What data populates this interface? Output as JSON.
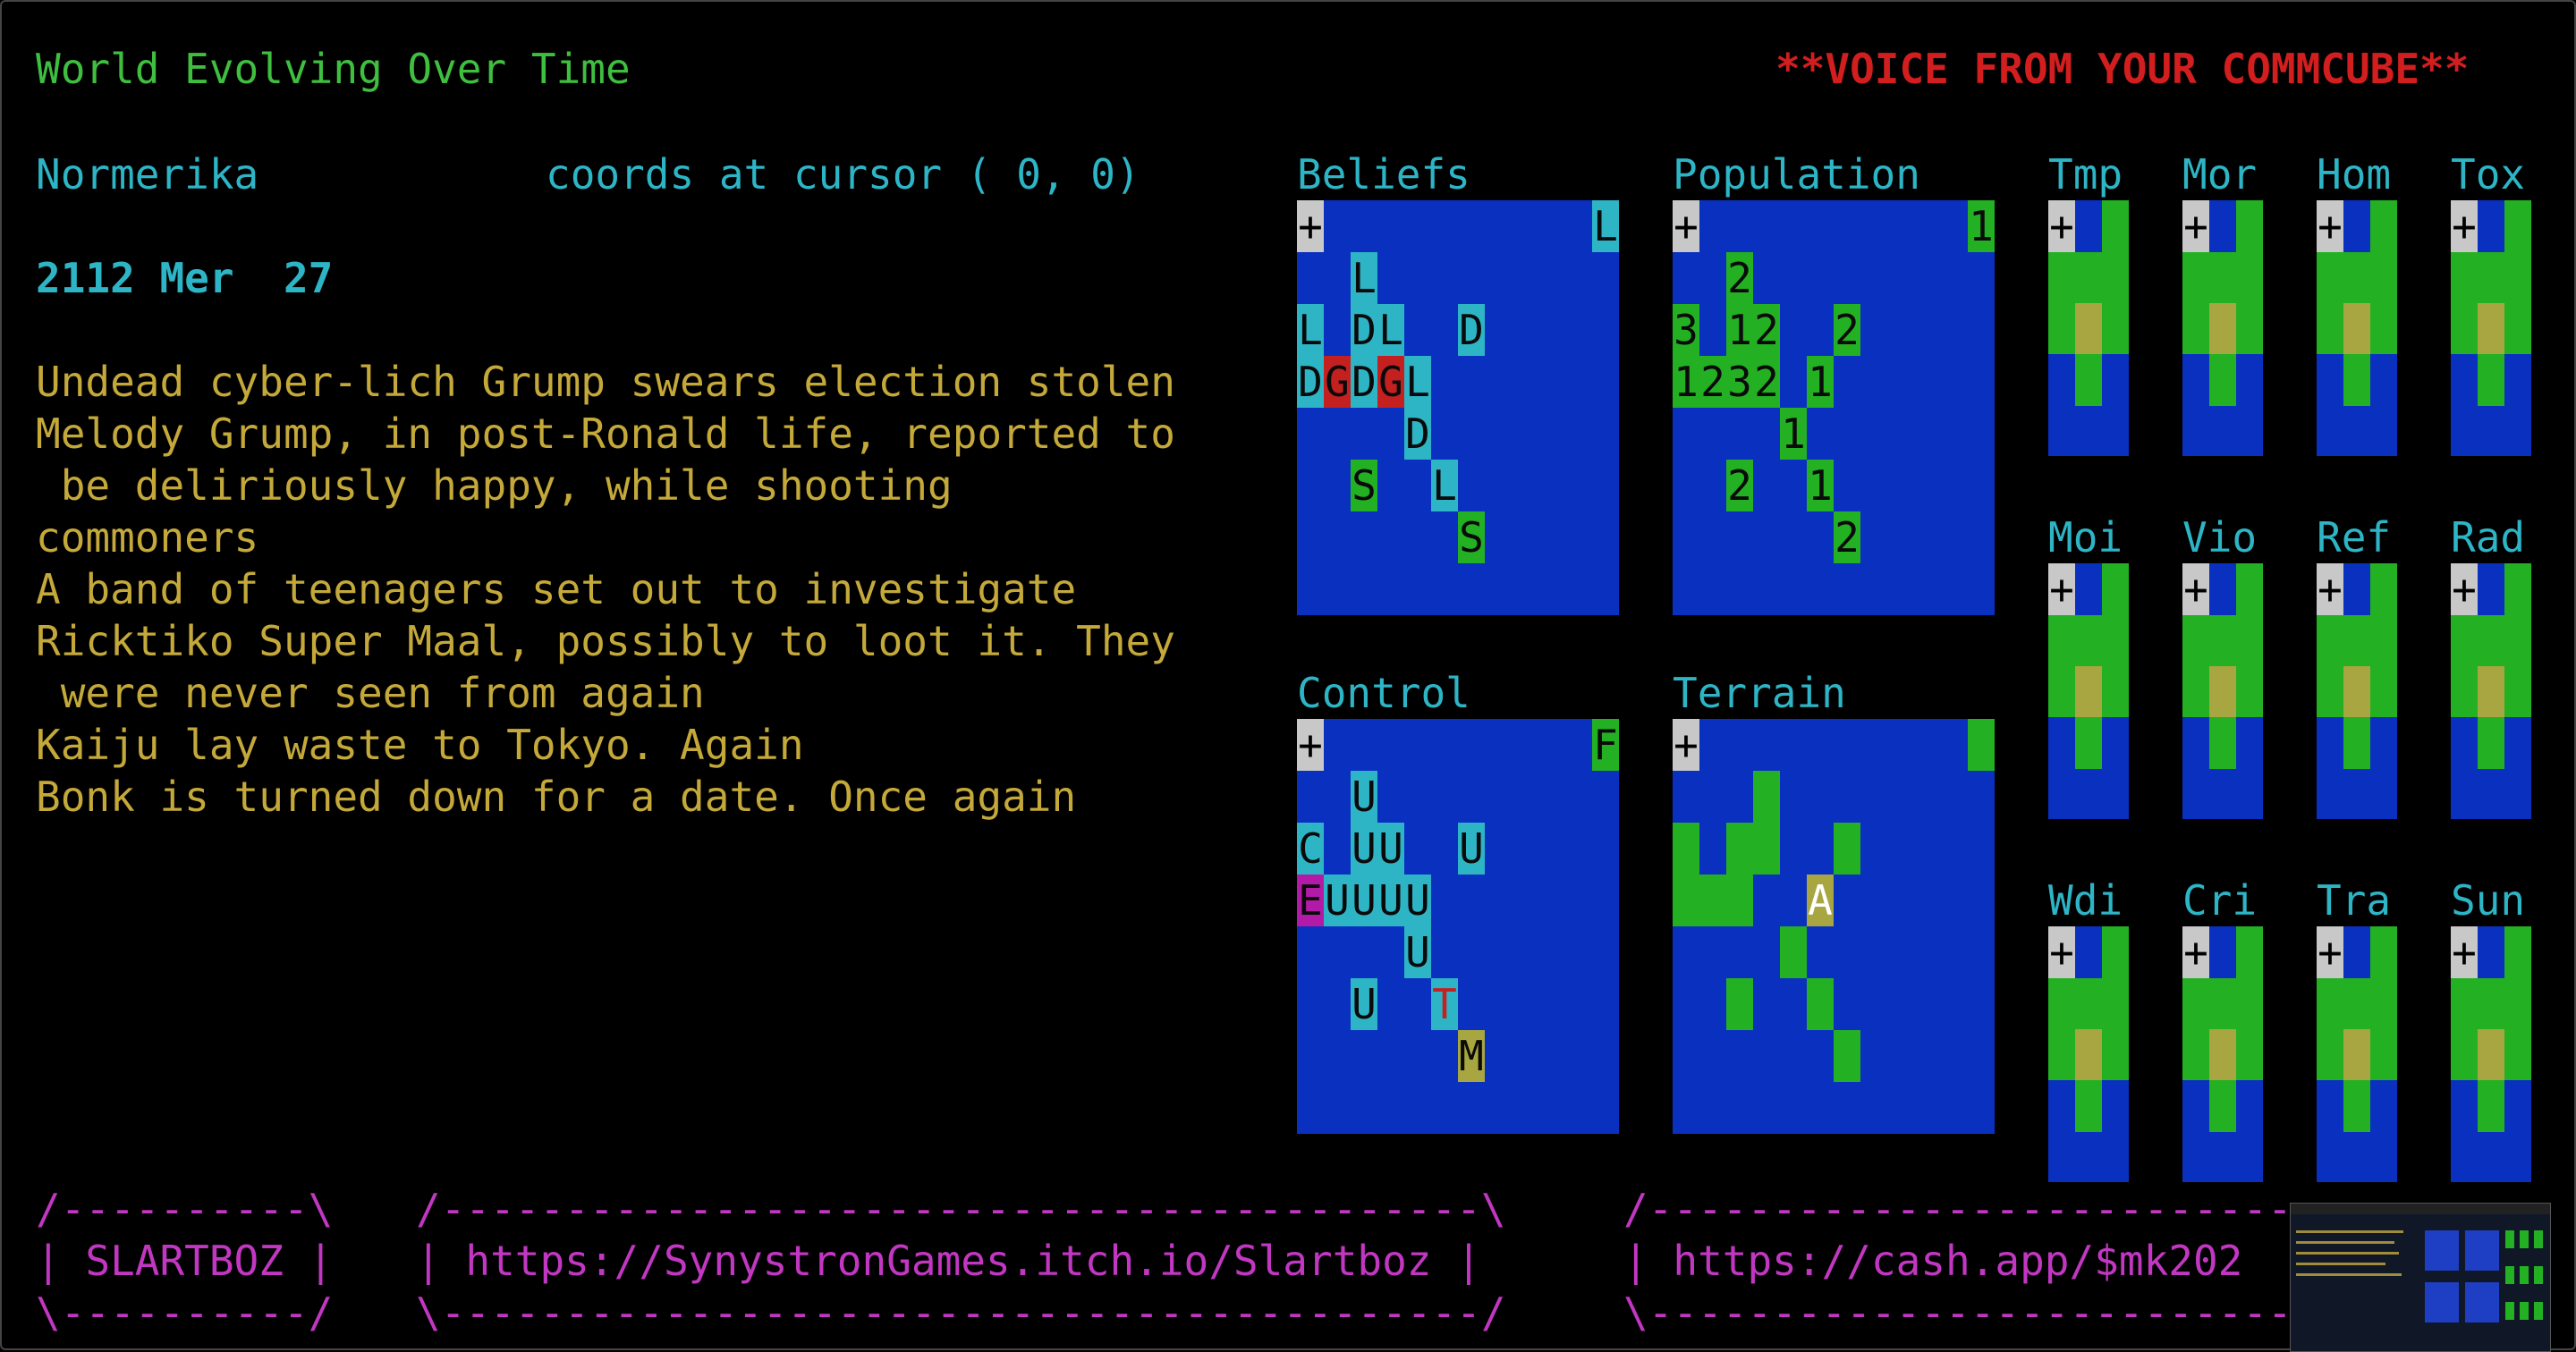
{
  "header": {
    "title": "World Evolving Over Time",
    "voice": "**VOICE FROM YOUR COMMCUBE**"
  },
  "location": {
    "region": "Normerika",
    "coords_text": "coords at cursor ( 0, 0)"
  },
  "date": "2112 Mer  27",
  "news": [
    "Undead cyber-lich Grump swears election stolen",
    "Melody Grump, in post-Ronald life, reported to",
    " be deliriously happy, while shooting",
    "commoners",
    "A band of teenagers set out to investigate",
    "Ricktiko Super Maal, possibly to loot it. They",
    " were never seen from again",
    "Kaiju lay waste to Tokyo. Again",
    "Bonk is turned down for a date. Once again"
  ],
  "maps": {
    "beliefs": {
      "title": "Beliefs",
      "plus": "+",
      "cells": [
        {
          "c": 5,
          "r": 0,
          "t": "L",
          "bg": "#2db5c6"
        },
        {
          "c": 1,
          "r": 1,
          "t": "L",
          "bg": "#2db5c6"
        },
        {
          "c": 0,
          "r": 2,
          "t": "L",
          "bg": "#2db5c6"
        },
        {
          "c": 1,
          "r": 2,
          "t": "D",
          "bg": "#2db5c6"
        },
        {
          "c": 1,
          "r": 2,
          "t": "L",
          "bg": "#2db5c6",
          "off": 1
        },
        {
          "c": 3,
          "r": 2,
          "t": "D",
          "bg": "#2db5c6"
        },
        {
          "c": 0,
          "r": 3,
          "t": "D",
          "bg": "#2db5c6"
        },
        {
          "c": 0,
          "r": 3,
          "t": "G",
          "bg": "#c42020",
          "off": 1
        },
        {
          "c": 1,
          "r": 3,
          "t": "D",
          "bg": "#2db5c6"
        },
        {
          "c": 1,
          "r": 3,
          "t": "G",
          "bg": "#c42020",
          "off": 1
        },
        {
          "c": 2,
          "r": 3,
          "t": "L",
          "bg": "#2db5c6"
        },
        {
          "c": 2,
          "r": 4,
          "t": "D",
          "bg": "#2db5c6"
        },
        {
          "c": 1,
          "r": 5,
          "t": "S",
          "bg": "#23b023"
        },
        {
          "c": 2,
          "r": 5,
          "t": "L",
          "bg": "#2db5c6",
          "off": 1
        },
        {
          "c": 3,
          "r": 6,
          "t": "S",
          "bg": "#23b023"
        }
      ]
    },
    "population": {
      "title": "Population",
      "plus": "+",
      "cells": [
        {
          "c": 5,
          "r": 0,
          "t": "1",
          "bg": "#23b023"
        },
        {
          "c": 1,
          "r": 1,
          "t": "2",
          "bg": "#23b023"
        },
        {
          "c": 0,
          "r": 2,
          "t": "3",
          "bg": "#23b023"
        },
        {
          "c": 1,
          "r": 2,
          "t": "1",
          "bg": "#23b023"
        },
        {
          "c": 1,
          "r": 2,
          "t": "2",
          "bg": "#23b023",
          "off": 1
        },
        {
          "c": 3,
          "r": 2,
          "t": "2",
          "bg": "#23b023"
        },
        {
          "c": 0,
          "r": 3,
          "t": "1",
          "bg": "#23b023"
        },
        {
          "c": 0,
          "r": 3,
          "t": "2",
          "bg": "#23b023",
          "off": 1
        },
        {
          "c": 1,
          "r": 3,
          "t": "3",
          "bg": "#23b023"
        },
        {
          "c": 1,
          "r": 3,
          "t": "2",
          "bg": "#23b023",
          "off": 1
        },
        {
          "c": 2,
          "r": 3,
          "t": "1",
          "bg": "#23b023",
          "off": 1
        },
        {
          "c": 2,
          "r": 4,
          "t": "1",
          "bg": "#23b023"
        },
        {
          "c": 1,
          "r": 5,
          "t": "2",
          "bg": "#23b023"
        },
        {
          "c": 2,
          "r": 5,
          "t": "1",
          "bg": "#23b023",
          "off": 1
        },
        {
          "c": 3,
          "r": 6,
          "t": "2",
          "bg": "#23b023"
        }
      ]
    },
    "control": {
      "title": "Control",
      "plus": "+",
      "cells": [
        {
          "c": 5,
          "r": 0,
          "t": "F",
          "bg": "#23b023"
        },
        {
          "c": 1,
          "r": 1,
          "t": "U",
          "bg": "#2db5c6"
        },
        {
          "c": 0,
          "r": 2,
          "t": "C",
          "bg": "#2db5c6"
        },
        {
          "c": 1,
          "r": 2,
          "t": "U",
          "bg": "#2db5c6"
        },
        {
          "c": 1,
          "r": 2,
          "t": "U",
          "bg": "#2db5c6",
          "off": 1
        },
        {
          "c": 3,
          "r": 2,
          "t": "U",
          "bg": "#2db5c6"
        },
        {
          "c": 0,
          "r": 3,
          "t": "E",
          "bg": "#b41aa8"
        },
        {
          "c": 0,
          "r": 3,
          "t": "U",
          "bg": "#2db5c6",
          "off": 1
        },
        {
          "c": 1,
          "r": 3,
          "t": "U",
          "bg": "#2db5c6"
        },
        {
          "c": 1,
          "r": 3,
          "t": "U",
          "bg": "#2db5c6",
          "off": 1
        },
        {
          "c": 2,
          "r": 3,
          "t": "U",
          "bg": "#2db5c6"
        },
        {
          "c": 2,
          "r": 4,
          "t": "U",
          "bg": "#2db5c6"
        },
        {
          "c": 1,
          "r": 5,
          "t": "U",
          "bg": "#2db5c6"
        },
        {
          "c": 2,
          "r": 5,
          "t": "T",
          "bg": "#2db5c6",
          "off": 1,
          "fg": "#c42020"
        },
        {
          "c": 3,
          "r": 6,
          "t": "M",
          "bg": "#a8a640"
        }
      ]
    },
    "terrain": {
      "title": "Terrain",
      "plus": "+",
      "blocks": [
        {
          "c": 5,
          "r": 0,
          "w": 1,
          "h": 1
        },
        {
          "c": 1,
          "r": 1,
          "w": 1,
          "h": 2,
          "off": 1
        },
        {
          "c": 0,
          "r": 2,
          "w": 1,
          "h": 2
        },
        {
          "c": 1,
          "r": 2,
          "w": 1,
          "h": 2
        },
        {
          "c": 0,
          "r": 3,
          "w": 2,
          "h": 1,
          "off": 1
        },
        {
          "c": 3,
          "r": 2,
          "w": 1,
          "h": 1
        },
        {
          "c": 2,
          "r": 4,
          "w": 1,
          "h": 1
        },
        {
          "c": 1,
          "r": 5,
          "w": 1,
          "h": 1
        },
        {
          "c": 2,
          "r": 5,
          "w": 1,
          "h": 1,
          "off": 1
        },
        {
          "c": 3,
          "r": 6,
          "w": 1,
          "h": 1
        }
      ],
      "special": {
        "c": 2,
        "r": 3,
        "t": "A",
        "bg": "#a8a640",
        "off": 1
      }
    }
  },
  "mini_charts": [
    {
      "label": "Tmp"
    },
    {
      "label": "Mor"
    },
    {
      "label": "Hom"
    },
    {
      "label": "Tox"
    },
    {
      "label": "Moi"
    },
    {
      "label": "Vio"
    },
    {
      "label": "Ref"
    },
    {
      "label": "Rad"
    },
    {
      "label": "Wdi"
    },
    {
      "label": "Cri"
    },
    {
      "label": "Tra"
    },
    {
      "label": "Sun"
    }
  ],
  "footer": {
    "box1_top": "/----------\\",
    "box1_mid": "| SLARTBOZ |",
    "box1_bot": "\\----------/",
    "box2_top": "/------------------------------------------\\",
    "box2_mid": "| https://SynystronGames.itch.io/Slartboz |",
    "box2_bot": "\\------------------------------------------/",
    "box3_top": "/--------------------------",
    "box3_mid": "| https://cash.app/$mk202",
    "box3_bot": "\\--------------------------"
  },
  "colors": {
    "green_text": "#3fbf3f",
    "cyan_text": "#2db5c6",
    "news_text": "#c4a93a",
    "voice_red": "#d21e1e",
    "footer_magenta": "#c237c2",
    "map_blue": "#0a30c0",
    "land_green": "#23b023"
  }
}
